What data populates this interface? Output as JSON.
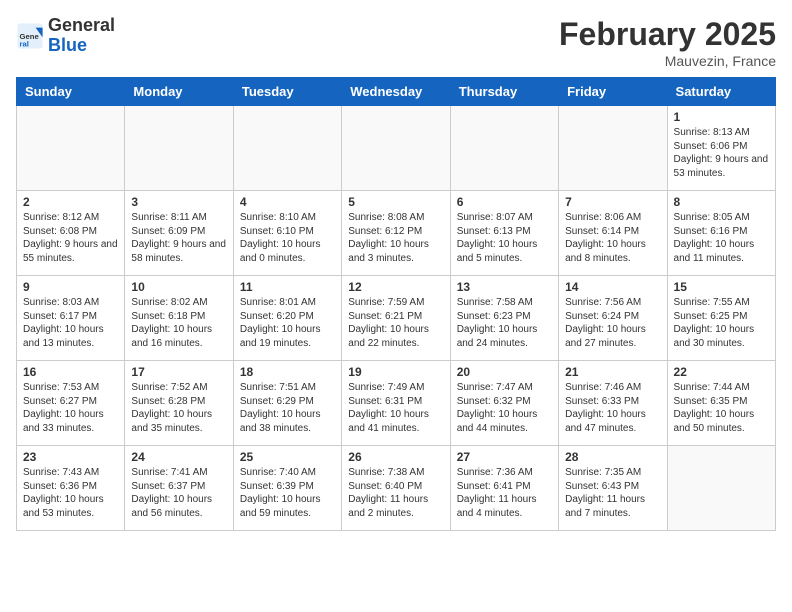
{
  "logo": {
    "text_general": "General",
    "text_blue": "Blue"
  },
  "header": {
    "title": "February 2025",
    "subtitle": "Mauvezin, France"
  },
  "weekdays": [
    "Sunday",
    "Monday",
    "Tuesday",
    "Wednesday",
    "Thursday",
    "Friday",
    "Saturday"
  ],
  "weeks": [
    [
      {
        "day": "",
        "info": ""
      },
      {
        "day": "",
        "info": ""
      },
      {
        "day": "",
        "info": ""
      },
      {
        "day": "",
        "info": ""
      },
      {
        "day": "",
        "info": ""
      },
      {
        "day": "",
        "info": ""
      },
      {
        "day": "1",
        "info": "Sunrise: 8:13 AM\nSunset: 6:06 PM\nDaylight: 9 hours and 53 minutes."
      }
    ],
    [
      {
        "day": "2",
        "info": "Sunrise: 8:12 AM\nSunset: 6:08 PM\nDaylight: 9 hours and 55 minutes."
      },
      {
        "day": "3",
        "info": "Sunrise: 8:11 AM\nSunset: 6:09 PM\nDaylight: 9 hours and 58 minutes."
      },
      {
        "day": "4",
        "info": "Sunrise: 8:10 AM\nSunset: 6:10 PM\nDaylight: 10 hours and 0 minutes."
      },
      {
        "day": "5",
        "info": "Sunrise: 8:08 AM\nSunset: 6:12 PM\nDaylight: 10 hours and 3 minutes."
      },
      {
        "day": "6",
        "info": "Sunrise: 8:07 AM\nSunset: 6:13 PM\nDaylight: 10 hours and 5 minutes."
      },
      {
        "day": "7",
        "info": "Sunrise: 8:06 AM\nSunset: 6:14 PM\nDaylight: 10 hours and 8 minutes."
      },
      {
        "day": "8",
        "info": "Sunrise: 8:05 AM\nSunset: 6:16 PM\nDaylight: 10 hours and 11 minutes."
      }
    ],
    [
      {
        "day": "9",
        "info": "Sunrise: 8:03 AM\nSunset: 6:17 PM\nDaylight: 10 hours and 13 minutes."
      },
      {
        "day": "10",
        "info": "Sunrise: 8:02 AM\nSunset: 6:18 PM\nDaylight: 10 hours and 16 minutes."
      },
      {
        "day": "11",
        "info": "Sunrise: 8:01 AM\nSunset: 6:20 PM\nDaylight: 10 hours and 19 minutes."
      },
      {
        "day": "12",
        "info": "Sunrise: 7:59 AM\nSunset: 6:21 PM\nDaylight: 10 hours and 22 minutes."
      },
      {
        "day": "13",
        "info": "Sunrise: 7:58 AM\nSunset: 6:23 PM\nDaylight: 10 hours and 24 minutes."
      },
      {
        "day": "14",
        "info": "Sunrise: 7:56 AM\nSunset: 6:24 PM\nDaylight: 10 hours and 27 minutes."
      },
      {
        "day": "15",
        "info": "Sunrise: 7:55 AM\nSunset: 6:25 PM\nDaylight: 10 hours and 30 minutes."
      }
    ],
    [
      {
        "day": "16",
        "info": "Sunrise: 7:53 AM\nSunset: 6:27 PM\nDaylight: 10 hours and 33 minutes."
      },
      {
        "day": "17",
        "info": "Sunrise: 7:52 AM\nSunset: 6:28 PM\nDaylight: 10 hours and 35 minutes."
      },
      {
        "day": "18",
        "info": "Sunrise: 7:51 AM\nSunset: 6:29 PM\nDaylight: 10 hours and 38 minutes."
      },
      {
        "day": "19",
        "info": "Sunrise: 7:49 AM\nSunset: 6:31 PM\nDaylight: 10 hours and 41 minutes."
      },
      {
        "day": "20",
        "info": "Sunrise: 7:47 AM\nSunset: 6:32 PM\nDaylight: 10 hours and 44 minutes."
      },
      {
        "day": "21",
        "info": "Sunrise: 7:46 AM\nSunset: 6:33 PM\nDaylight: 10 hours and 47 minutes."
      },
      {
        "day": "22",
        "info": "Sunrise: 7:44 AM\nSunset: 6:35 PM\nDaylight: 10 hours and 50 minutes."
      }
    ],
    [
      {
        "day": "23",
        "info": "Sunrise: 7:43 AM\nSunset: 6:36 PM\nDaylight: 10 hours and 53 minutes."
      },
      {
        "day": "24",
        "info": "Sunrise: 7:41 AM\nSunset: 6:37 PM\nDaylight: 10 hours and 56 minutes."
      },
      {
        "day": "25",
        "info": "Sunrise: 7:40 AM\nSunset: 6:39 PM\nDaylight: 10 hours and 59 minutes."
      },
      {
        "day": "26",
        "info": "Sunrise: 7:38 AM\nSunset: 6:40 PM\nDaylight: 11 hours and 2 minutes."
      },
      {
        "day": "27",
        "info": "Sunrise: 7:36 AM\nSunset: 6:41 PM\nDaylight: 11 hours and 4 minutes."
      },
      {
        "day": "28",
        "info": "Sunrise: 7:35 AM\nSunset: 6:43 PM\nDaylight: 11 hours and 7 minutes."
      },
      {
        "day": "",
        "info": ""
      }
    ]
  ]
}
